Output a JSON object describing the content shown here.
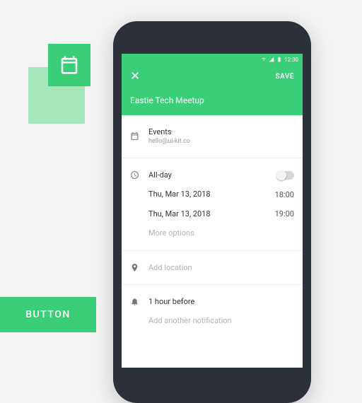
{
  "deco": {
    "button_label": "BUTTON"
  },
  "statusbar": {
    "time": "12:30"
  },
  "header": {
    "save_label": "SAVE",
    "event_title": "Eastie Tech Meetup"
  },
  "calendar_row": {
    "title": "Events",
    "subtitle": "hello@ui-kit.co"
  },
  "allday": {
    "label": "All-day"
  },
  "times": {
    "start_date": "Thu, Mar 13, 2018",
    "start_time": "18:00",
    "end_date": "Thu, Mar 13, 2018",
    "end_time": "19:00",
    "more_label": "More options"
  },
  "location": {
    "placeholder": "Add location"
  },
  "notification": {
    "current": "1 hour before",
    "add_label": "Add another notification"
  }
}
